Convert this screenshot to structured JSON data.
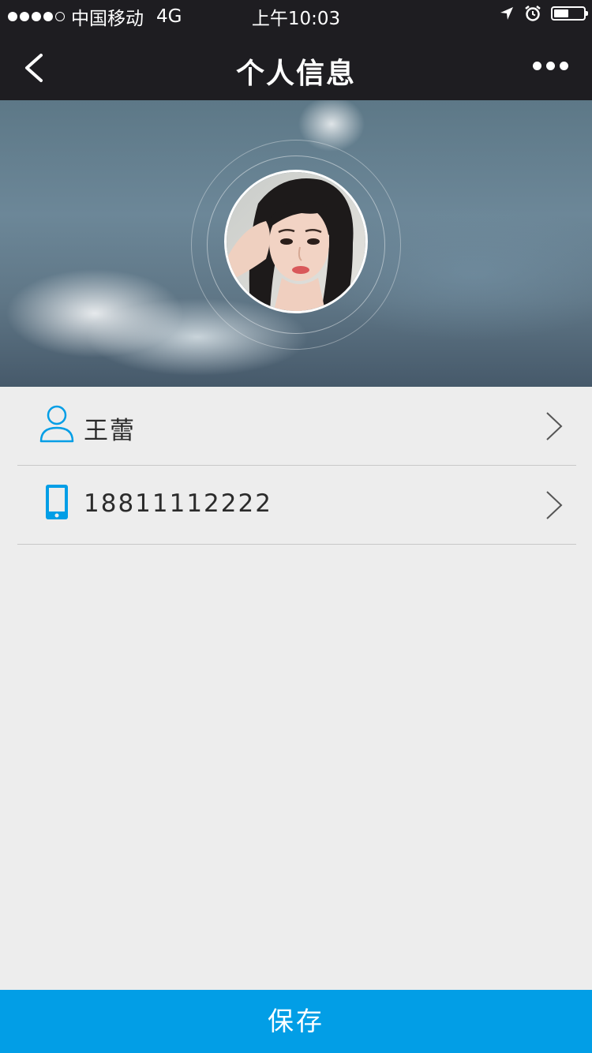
{
  "status_bar": {
    "carrier": "中国移动",
    "network": "4G",
    "time": "上午10:03",
    "signal_bars_filled": 4,
    "signal_bars_total": 5,
    "battery_level": 0.45
  },
  "nav": {
    "title": "个人信息",
    "back_icon": "chevron-left-icon",
    "more_icon": "more-dots-icon"
  },
  "profile": {
    "avatar_icon": "user-avatar-photo"
  },
  "rows": [
    {
      "icon": "user-icon",
      "value": "王蕾"
    },
    {
      "icon": "phone-icon",
      "value": "18811112222"
    }
  ],
  "save_label": "保存",
  "colors": {
    "accent": "#029ee6",
    "topbar": "#1e1d21",
    "background": "#ededed"
  }
}
